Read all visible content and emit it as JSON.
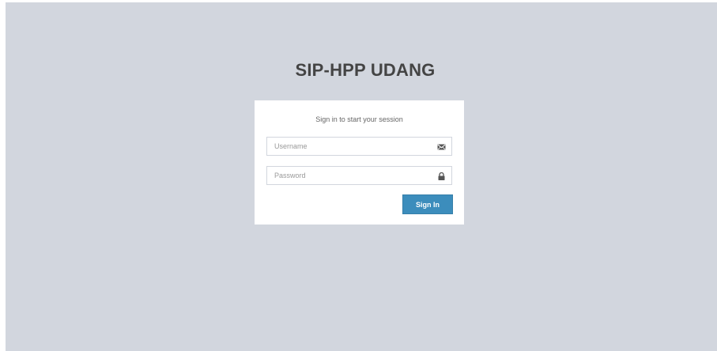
{
  "app": {
    "title": "SIP-HPP UDANG"
  },
  "login": {
    "message": "Sign in to start your session",
    "username": {
      "placeholder": "Username",
      "value": "",
      "icon": "envelope-icon"
    },
    "password": {
      "placeholder": "Password",
      "value": "",
      "icon": "lock-icon"
    },
    "submit_label": "Sign In"
  },
  "colors": {
    "background": "#d2d6de",
    "card": "#ffffff",
    "primary_button": "#3c8dbc",
    "title_text": "#444444"
  }
}
